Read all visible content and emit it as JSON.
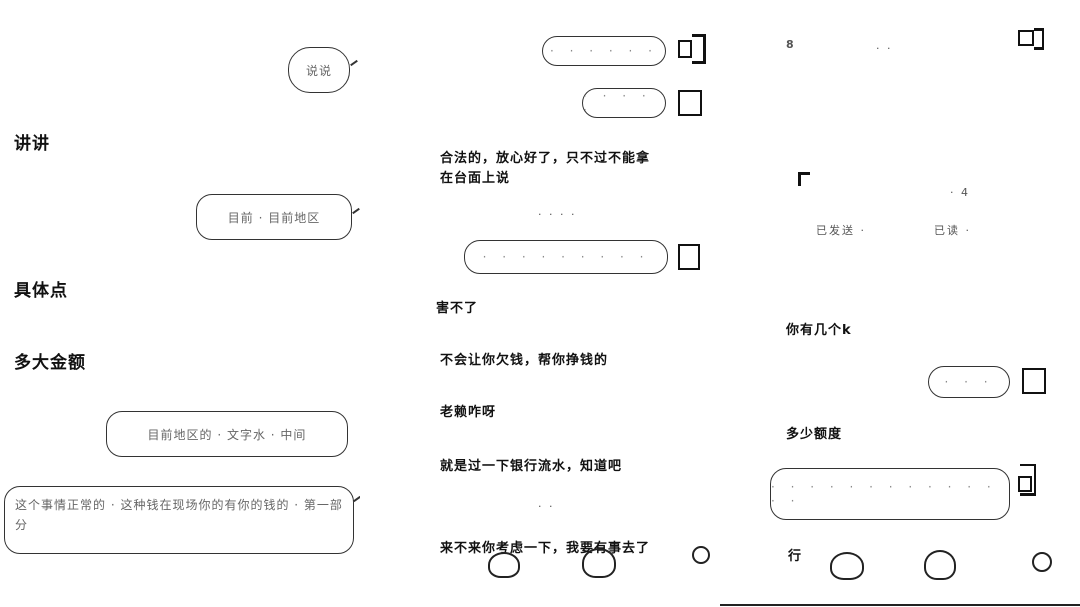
{
  "panel1": {
    "messages": [
      "讲讲",
      "具体点",
      "多大金额"
    ],
    "bubbles": [
      "说说",
      "目前 · 目前地区",
      "目前地区的 · 文字水 · 中间",
      "这个事情正常的 · 这种钱在现场你的有你的钱的 · 第一部分"
    ]
  },
  "panel2": {
    "messages": [
      "合法的，放心好了，只不过不能拿",
      "在台面上说",
      "害不了",
      "不会让你欠钱，帮你挣钱的",
      "老赖咋呀",
      "就是过一下银行流水，知道吧",
      "来不来你考虑一下，我要有事去了"
    ],
    "fragments": [
      "· · · ·",
      "· ·"
    ],
    "bubbles": [
      "· · · · · ·",
      "· · · · ·",
      "· · · · · · · · ·"
    ]
  },
  "panel3": {
    "fragments": [
      "8",
      "· ·",
      "· 4",
      "已发送 ·",
      "已读 ·"
    ],
    "messages": [
      "你有几个k",
      "多少额度",
      "行"
    ],
    "bubbles": [
      "· · ·",
      "· · · · · · ·  · · · · · · ·"
    ]
  }
}
